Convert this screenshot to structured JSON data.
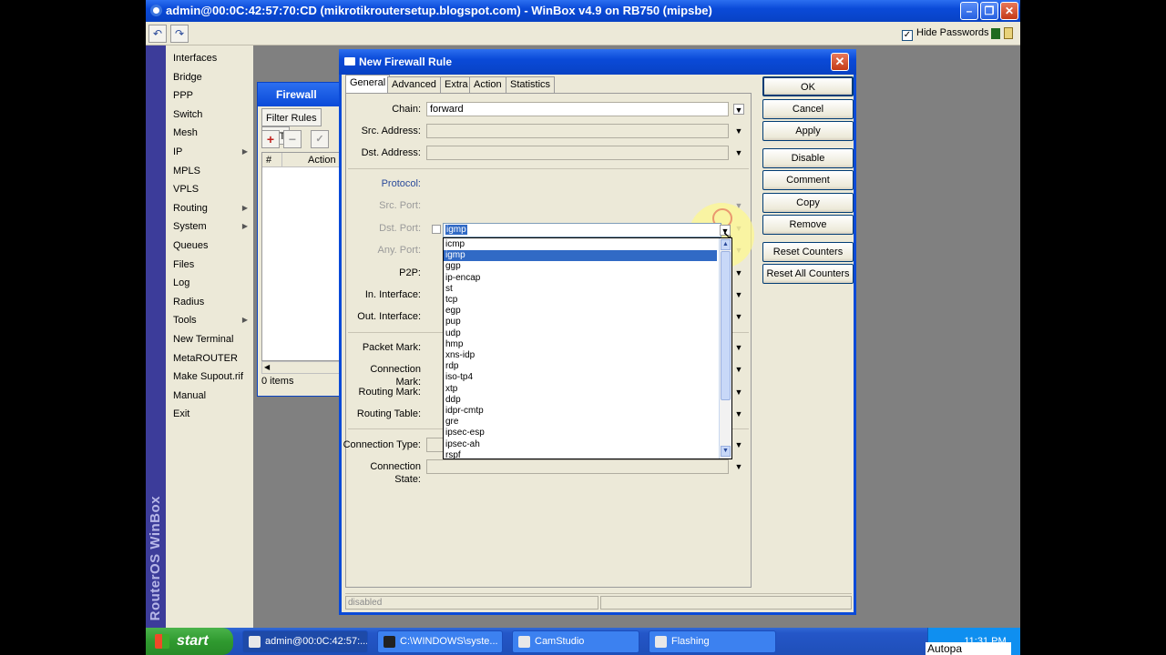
{
  "window": {
    "title": "admin@00:0C:42:57:70:CD (mikrotikroutersetup.blogspot.com) - WinBox v4.9 on RB750 (mipsbe)"
  },
  "toolbar": {
    "undo_icon": "undo-icon",
    "redo_icon": "redo-icon",
    "hide_passwords_label": "Hide Passwords",
    "hide_passwords_checked": true
  },
  "banner": {
    "text": "RouterOS WinBox"
  },
  "menu": {
    "items": [
      {
        "label": "Interfaces"
      },
      {
        "label": "Bridge"
      },
      {
        "label": "PPP"
      },
      {
        "label": "Switch"
      },
      {
        "label": "Mesh"
      },
      {
        "label": "IP",
        "submenu": true
      },
      {
        "label": "MPLS"
      },
      {
        "label": "VPLS"
      },
      {
        "label": "Routing",
        "submenu": true
      },
      {
        "label": "System",
        "submenu": true
      },
      {
        "label": "Queues"
      },
      {
        "label": "Files"
      },
      {
        "label": "Log"
      },
      {
        "label": "Radius"
      },
      {
        "label": "Tools",
        "submenu": true
      },
      {
        "label": "New Terminal"
      },
      {
        "label": "MetaROUTER"
      },
      {
        "label": "Make Supout.rif"
      },
      {
        "label": "Manual"
      },
      {
        "label": "Exit"
      }
    ]
  },
  "firewall": {
    "title": "Firewall",
    "tabs": [
      "Filter Rules",
      "NAT"
    ],
    "columns": [
      "#",
      "Action"
    ],
    "status": "0 items"
  },
  "dialog": {
    "title": "New Firewall Rule",
    "tabs": [
      "General",
      "Advanced",
      "Extra",
      "Action",
      "Statistics"
    ],
    "fields": {
      "chain": {
        "label": "Chain:",
        "value": "forward"
      },
      "src_address": {
        "label": "Src. Address:",
        "value": ""
      },
      "dst_address": {
        "label": "Dst. Address:",
        "value": ""
      },
      "protocol": {
        "label": "Protocol:",
        "value": "igmp"
      },
      "src_port": {
        "label": "Src. Port:"
      },
      "dst_port": {
        "label": "Dst. Port:"
      },
      "any_port": {
        "label": "Any. Port:"
      },
      "p2p": {
        "label": "P2P:"
      },
      "in_interface": {
        "label": "In. Interface:"
      },
      "out_interface": {
        "label": "Out. Interface:"
      },
      "packet_mark": {
        "label": "Packet Mark:"
      },
      "connection_mark": {
        "label": "Connection Mark:"
      },
      "routing_mark": {
        "label": "Routing Mark:"
      },
      "routing_table": {
        "label": "Routing Table:"
      },
      "connection_type": {
        "label": "Connection Type:",
        "value": ""
      },
      "connection_state": {
        "label": "Connection State:",
        "value": ""
      }
    },
    "protocol_options": [
      "icmp",
      "igmp",
      "ggp",
      "ip-encap",
      "st",
      "tcp",
      "egp",
      "pup",
      "udp",
      "hmp",
      "xns-idp",
      "rdp",
      "iso-tp4",
      "xtp",
      "ddp",
      "idpr-cmtp",
      "gre",
      "ipsec-esp",
      "ipsec-ah",
      "rspf"
    ],
    "protocol_selected": "igmp",
    "buttons": [
      "OK",
      "Cancel",
      "Apply",
      "Disable",
      "Comment",
      "Copy",
      "Remove",
      "Reset Counters",
      "Reset All Counters"
    ],
    "status": "disabled"
  },
  "taskbar": {
    "start": "start",
    "tasks": [
      {
        "label": "admin@00:0C:42:57:...",
        "active": true
      },
      {
        "label": "C:\\WINDOWS\\syste..."
      },
      {
        "label": "CamStudio"
      },
      {
        "label": "Flashing"
      }
    ],
    "clock": "11:31 PM",
    "overlay_text": "Autopa"
  }
}
